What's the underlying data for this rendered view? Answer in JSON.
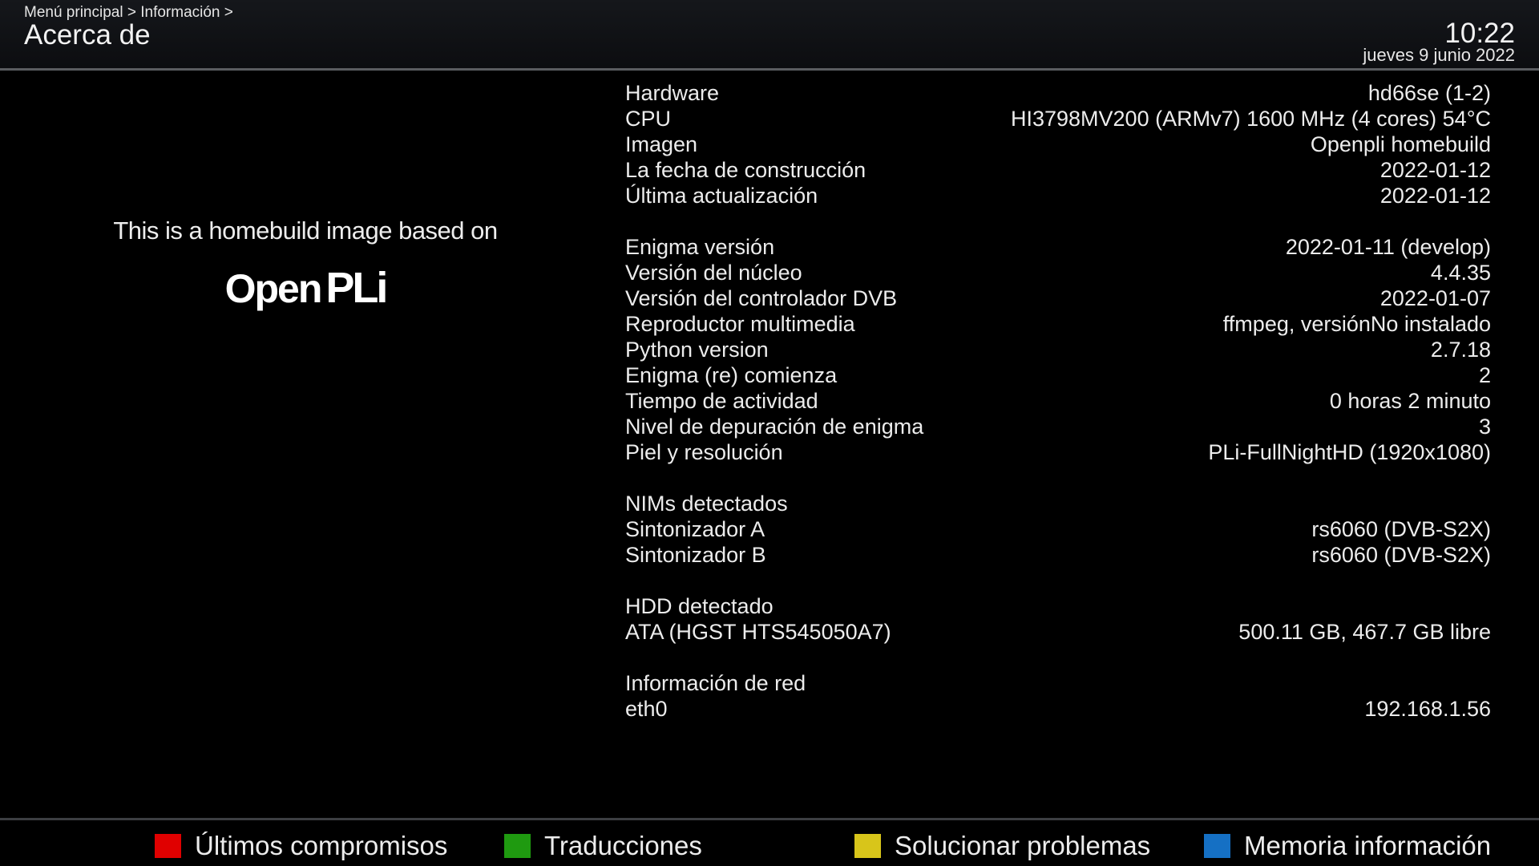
{
  "header": {
    "breadcrumb": "Menú principal > Información >",
    "title": "Acerca de",
    "time": "10:22",
    "date": "jueves  9 junio 2022"
  },
  "logo": {
    "tagline": "This is a homebuild image based on",
    "brand_open": "Open",
    "brand_pli": "PLi"
  },
  "info": {
    "hardware": {
      "label": "Hardware",
      "value": "hd66se (1-2)"
    },
    "cpu": {
      "label": "CPU",
      "value": "HI3798MV200 (ARMv7) 1600 MHz (4 cores) 54°C"
    },
    "image": {
      "label": "Imagen",
      "value": "Openpli homebuild"
    },
    "build_date": {
      "label": "La fecha de construcción",
      "value": "2022-01-12"
    },
    "last_update": {
      "label": "Última actualización",
      "value": "2022-01-12"
    },
    "enigma_version": {
      "label": "Enigma versión",
      "value": "2022-01-11 (develop)"
    },
    "kernel_version": {
      "label": "Versión del núcleo",
      "value": "4.4.35"
    },
    "dvb_driver": {
      "label": "Versión del controlador DVB",
      "value": "2022-01-07"
    },
    "media_player": {
      "label": "Reproductor multimedia",
      "value": "ffmpeg, versiónNo instalado"
    },
    "python_version": {
      "label": "Python version",
      "value": "2.7.18"
    },
    "enigma_restarts": {
      "label": "Enigma (re) comienza",
      "value": "2"
    },
    "uptime": {
      "label": "Tiempo de actividad",
      "value": "0 horas 2 minuto"
    },
    "debug_level": {
      "label": "Nivel de depuración de enigma",
      "value": "3"
    },
    "skin": {
      "label": "Piel y resolución",
      "value": "PLi-FullNightHD (1920x1080)"
    },
    "nims_header": "NIMs detectados",
    "tuner_a": {
      "label": "Sintonizador A",
      "value": "rs6060 (DVB-S2X)"
    },
    "tuner_b": {
      "label": "Sintonizador B",
      "value": "rs6060 (DVB-S2X)"
    },
    "hdd_header": "HDD detectado",
    "hdd": {
      "label": "ATA (HGST HTS545050A7)",
      "value": "500.11 GB, 467.7 GB libre"
    },
    "network_header": "Información de red",
    "eth0": {
      "label": "eth0",
      "value": "192.168.1.56"
    }
  },
  "footer": {
    "red": {
      "label": "Últimos compromisos",
      "color": "#e00000"
    },
    "green": {
      "label": "Traducciones",
      "color": "#1f9a10"
    },
    "yellow": {
      "label": "Solucionar problemas",
      "color": "#d8c51a"
    },
    "blue": {
      "label": "Memoria información",
      "color": "#1570c4"
    }
  }
}
